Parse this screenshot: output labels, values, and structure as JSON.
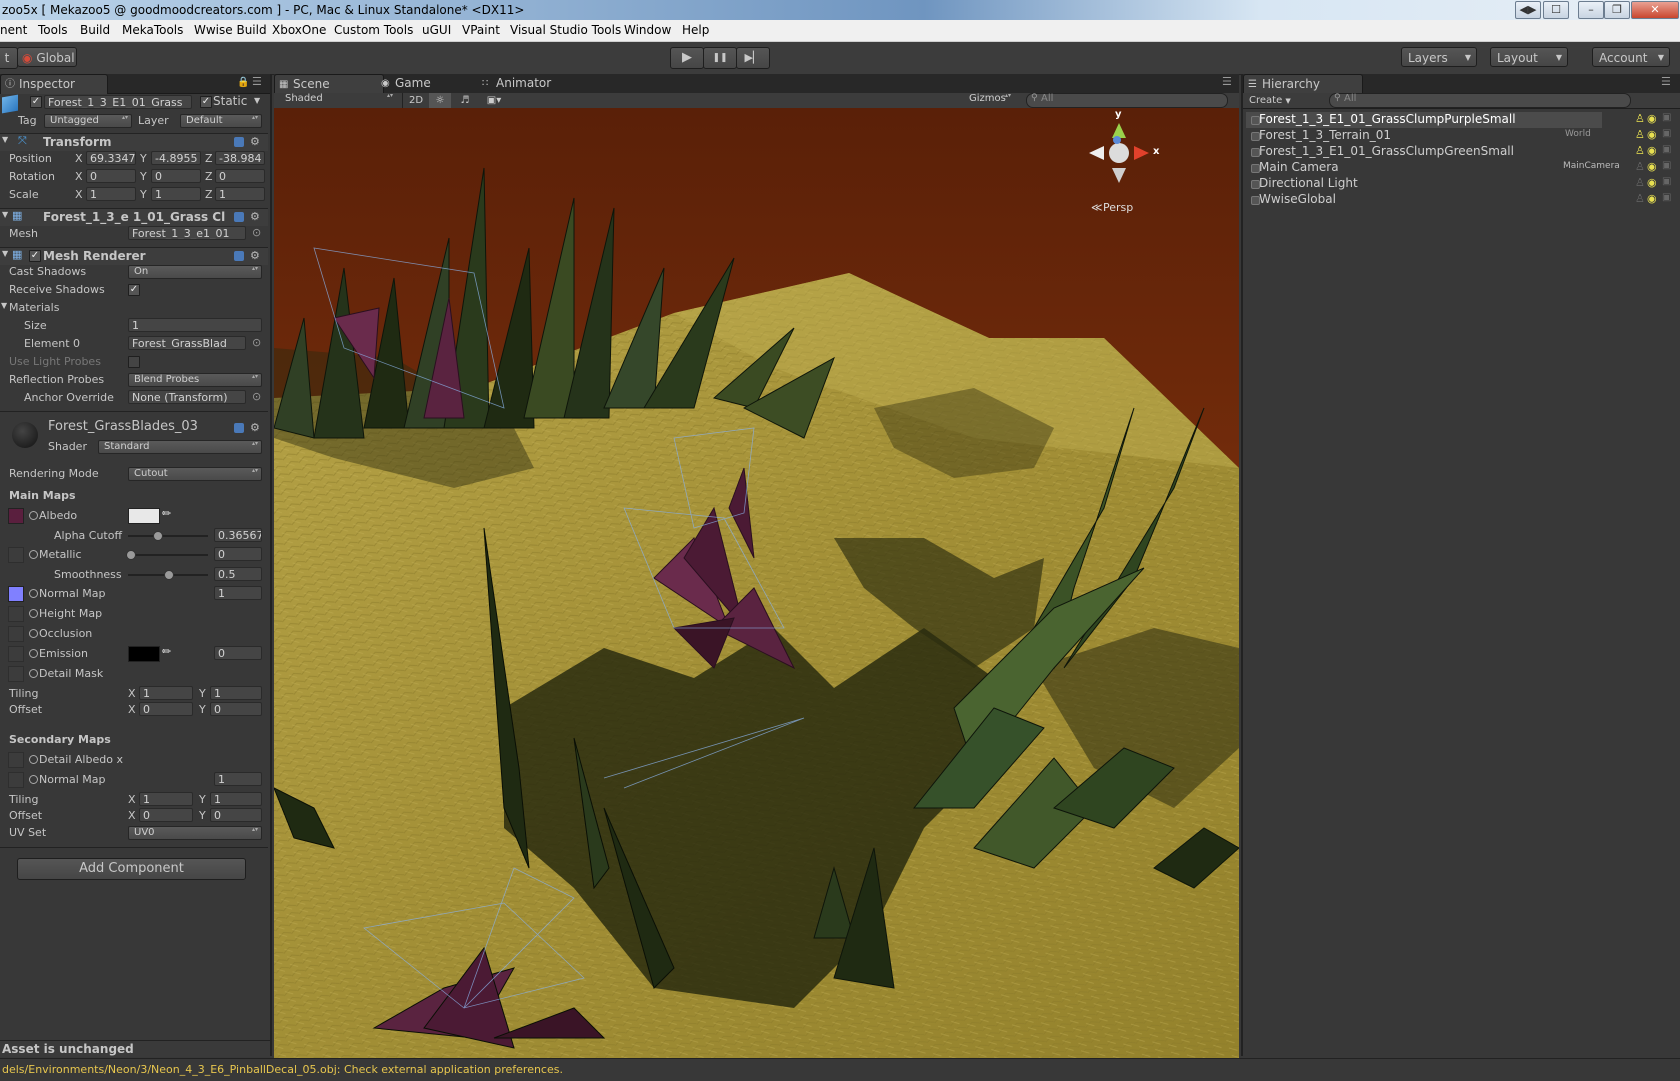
{
  "window": {
    "title": "zoo5x [ Mekazoo5 @ goodmoodcreators.com ] - PC, Mac & Linux Standalone* <DX11>",
    "buttons": [
      "◀▶",
      "☐",
      "–",
      "❐",
      "✕"
    ]
  },
  "menu": [
    "nent",
    "Tools",
    "Build",
    "MekaTools",
    "Wwise Build",
    "XboxOne",
    "Custom Tools",
    "uGUI",
    "VPaint",
    "Visual Studio Tools",
    "Window",
    "Help"
  ],
  "toolbar": {
    "pivot": "t",
    "global": "Global",
    "play_icon": "▶",
    "pause_icon": "❚❚",
    "step_icon": "▶▏",
    "layers": "Layers",
    "layout": "Layout",
    "account": "Account"
  },
  "inspector": {
    "tab": "Inspector",
    "object_name": "Forest_1_3_E1_01_Grass",
    "static_label": "Static",
    "tag_label": "Tag",
    "tag_value": "Untagged",
    "layer_label": "Layer",
    "layer_value": "Default",
    "transform": {
      "title": "Transform",
      "position_label": "Position",
      "rotation_label": "Rotation",
      "scale_label": "Scale",
      "position": {
        "x": "69.3347",
        "y": "-4.8955",
        "z": "-38.984"
      },
      "rotation": {
        "x": "0",
        "y": "0",
        "z": "0"
      },
      "scale": {
        "x": "1",
        "y": "1",
        "z": "1"
      }
    },
    "mesh_filter": {
      "title": "Forest_1_3_e 1_01_Grass Cl",
      "mesh_label": "Mesh",
      "mesh_value": "Forest_1_3_e1_01"
    },
    "mesh_renderer": {
      "title": "Mesh Renderer",
      "cast_shadows_label": "Cast Shadows",
      "cast_shadows_value": "On",
      "receive_shadows_label": "Receive Shadows",
      "materials_label": "Materials",
      "size_label": "Size",
      "size_value": "1",
      "element0_label": "Element 0",
      "element0_value": "Forest_GrassBlad",
      "use_light_probes_label": "Use Light Probes",
      "reflection_probes_label": "Reflection Probes",
      "reflection_probes_value": "Blend Probes",
      "anchor_override_label": "Anchor Override",
      "anchor_override_value": "None (Transform)"
    },
    "material": {
      "name": "Forest_GrassBlades_03",
      "shader_label": "Shader",
      "shader_value": "Standard",
      "rendering_mode_label": "Rendering Mode",
      "rendering_mode_value": "Cutout",
      "main_maps_label": "Main Maps",
      "albedo_label": "Albedo",
      "alpha_cutoff_label": "Alpha Cutoff",
      "alpha_cutoff_value": "0.36567",
      "metallic_label": "Metallic",
      "metallic_value": "0",
      "smoothness_label": "Smoothness",
      "smoothness_value": "0.5",
      "normal_map_label": "Normal Map",
      "normal_map_value": "1",
      "height_map_label": "Height Map",
      "occlusion_label": "Occlusion",
      "emission_label": "Emission",
      "emission_value": "0",
      "detail_mask_label": "Detail Mask",
      "tiling_label": "Tiling",
      "offset_label": "Offset",
      "tiling": {
        "x": "1",
        "y": "1"
      },
      "offset": {
        "x": "0",
        "y": "0"
      },
      "secondary_maps_label": "Secondary Maps",
      "detail_albedo_label": "Detail Albedo x",
      "normal_map2_label": "Normal Map",
      "normal_map2_value": "1",
      "tiling2": {
        "x": "1",
        "y": "1"
      },
      "offset2": {
        "x": "0",
        "y": "0"
      },
      "uv_set_label": "UV Set",
      "uv_set_value": "UV0",
      "axis_x": "X",
      "axis_y": "Y",
      "axis_z": "Z"
    },
    "add_component": "Add Component",
    "status": "Asset is unchanged"
  },
  "scene": {
    "tabs": [
      "Scene",
      "Game",
      "Animator"
    ],
    "shading_mode": "Shaded",
    "mode_2d": "2D",
    "gizmos": "Gizmos",
    "search_placeholder": "All",
    "persp_label": "Persp",
    "axis_y": "y",
    "axis_x": "x",
    "colors": {
      "sky": "#7a2f0c",
      "ground": "#a8953a",
      "grass_dark": "#1f2a12",
      "grass_purple": "#5a2340"
    }
  },
  "hierarchy": {
    "tab": "Hierarchy",
    "create": "Create",
    "search_placeholder": "All",
    "items": [
      {
        "name": "Forest_1_3_E1_01_GrassClumpPurpleSmall",
        "tag": ""
      },
      {
        "name": "Forest_1_3_Terrain_01",
        "tag": "World"
      },
      {
        "name": "Forest_1_3_E1_01_GrassClumpGreenSmall",
        "tag": ""
      },
      {
        "name": "Main Camera",
        "tag": "MainCamera"
      },
      {
        "name": "Directional Light",
        "tag": ""
      },
      {
        "name": "WwiseGlobal",
        "tag": ""
      }
    ]
  },
  "console": {
    "message": "dels/Environments/Neon/3/Neon_4_3_E6_PinballDecal_05.obj: Check external application preferences."
  }
}
